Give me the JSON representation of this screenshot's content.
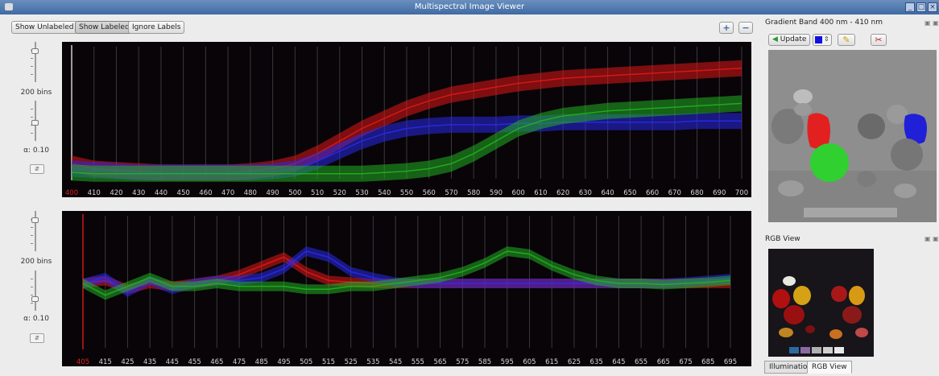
{
  "window": {
    "title": "Multispectral Image Viewer"
  },
  "toolbar": {
    "show_unlabeled": "Show Unlabeled",
    "show_labeled": "Show Labeled",
    "ignore_labels": "Ignore Labels"
  },
  "top_plot": {
    "bins_label": "200 bins",
    "alpha_label": "α: 0.10",
    "bins_level": 0.18,
    "alpha_level": 0.55,
    "ticks": [
      "400",
      "410",
      "420",
      "430",
      "440",
      "450",
      "460",
      "470",
      "480",
      "490",
      "500",
      "510",
      "520",
      "530",
      "540",
      "550",
      "560",
      "570",
      "580",
      "590",
      "600",
      "610",
      "620",
      "630",
      "640",
      "650",
      "660",
      "670",
      "680",
      "690",
      "700"
    ],
    "selected_tick": "400"
  },
  "bottom_plot": {
    "bins_label": "200 bins",
    "alpha_label": "α: 0.10",
    "bins_level": 0.18,
    "alpha_level": 0.75,
    "ticks": [
      "405",
      "415",
      "425",
      "435",
      "445",
      "455",
      "465",
      "475",
      "485",
      "495",
      "505",
      "515",
      "525",
      "535",
      "545",
      "555",
      "565",
      "575",
      "585",
      "595",
      "605",
      "615",
      "625",
      "635",
      "645",
      "655",
      "665",
      "675",
      "685",
      "695"
    ],
    "selected_tick": "405"
  },
  "side_panel": {
    "gradient_title": "Gradient Band 400 nm - 410 nm",
    "update_label": "Update",
    "label_color": "#1010e0",
    "rgb_title": "RGB View",
    "tabs": [
      "Illumination",
      "RGB View"
    ],
    "active_tab": "RGB View"
  },
  "icons": {
    "zoom_in": "+",
    "zoom_out": "−",
    "update": "arrow-left-icon",
    "marker": "marker-icon",
    "clear": "scissors-icon"
  },
  "chart_data": [
    {
      "type": "line",
      "x": [
        400,
        410,
        420,
        430,
        440,
        450,
        460,
        470,
        480,
        490,
        500,
        510,
        520,
        530,
        540,
        550,
        560,
        570,
        580,
        590,
        600,
        610,
        620,
        630,
        640,
        650,
        660,
        670,
        680,
        690,
        700
      ],
      "xlim": [
        400,
        700
      ],
      "grid": true,
      "series": [
        {
          "color": "#e01818",
          "values": [
            0.12,
            0.08,
            0.07,
            0.06,
            0.05,
            0.05,
            0.05,
            0.05,
            0.06,
            0.08,
            0.12,
            0.2,
            0.3,
            0.4,
            0.48,
            0.56,
            0.62,
            0.67,
            0.7,
            0.73,
            0.76,
            0.78,
            0.8,
            0.81,
            0.82,
            0.83,
            0.84,
            0.85,
            0.86,
            0.87,
            0.88
          ]
        },
        {
          "color": "#2a2ae8",
          "values": [
            0.08,
            0.07,
            0.06,
            0.05,
            0.05,
            0.05,
            0.05,
            0.05,
            0.05,
            0.06,
            0.08,
            0.14,
            0.22,
            0.3,
            0.36,
            0.4,
            0.42,
            0.43,
            0.43,
            0.43,
            0.44,
            0.44,
            0.45,
            0.45,
            0.45,
            0.45,
            0.45,
            0.45,
            0.46,
            0.46,
            0.46
          ]
        },
        {
          "color": "#22b022",
          "values": [
            0.05,
            0.04,
            0.04,
            0.04,
            0.04,
            0.04,
            0.04,
            0.04,
            0.04,
            0.04,
            0.04,
            0.04,
            0.04,
            0.04,
            0.05,
            0.06,
            0.08,
            0.12,
            0.2,
            0.3,
            0.4,
            0.46,
            0.5,
            0.52,
            0.54,
            0.55,
            0.56,
            0.57,
            0.58,
            0.59,
            0.6
          ]
        }
      ]
    },
    {
      "type": "line",
      "x": [
        405,
        415,
        425,
        435,
        445,
        455,
        465,
        475,
        485,
        495,
        505,
        515,
        525,
        535,
        545,
        555,
        565,
        575,
        585,
        595,
        605,
        615,
        625,
        635,
        645,
        655,
        665,
        675,
        685,
        695
      ],
      "xlim": [
        405,
        695
      ],
      "grid": true,
      "series": [
        {
          "color": "#e01818",
          "values": [
            0.0,
            0.05,
            -0.1,
            0.0,
            -0.05,
            0.0,
            0.05,
            0.15,
            0.3,
            0.45,
            0.2,
            0.05,
            0.02,
            0.0,
            0.0,
            0.0,
            0.0,
            0.0,
            0.0,
            0.0,
            0.0,
            0.0,
            0.0,
            0.0,
            0.0,
            0.0,
            0.0,
            0.0,
            0.0,
            0.0
          ]
        },
        {
          "color": "#2a2ae8",
          "values": [
            0.0,
            0.1,
            -0.15,
            0.05,
            -0.1,
            0.0,
            0.05,
            0.05,
            0.1,
            0.25,
            0.55,
            0.45,
            0.2,
            0.1,
            0.02,
            0.0,
            0.0,
            0.0,
            0.0,
            0.0,
            0.0,
            0.0,
            0.0,
            0.0,
            0.0,
            0.0,
            0.0,
            0.02,
            0.05,
            0.08
          ]
        },
        {
          "color": "#22b022",
          "values": [
            0.0,
            -0.2,
            -0.05,
            0.1,
            -0.05,
            -0.05,
            0.0,
            -0.05,
            -0.05,
            -0.05,
            -0.1,
            -0.1,
            -0.05,
            -0.05,
            0.0,
            0.05,
            0.1,
            0.2,
            0.35,
            0.55,
            0.5,
            0.3,
            0.15,
            0.05,
            0.0,
            0.0,
            -0.02,
            0.0,
            0.02,
            0.05
          ]
        }
      ]
    }
  ]
}
